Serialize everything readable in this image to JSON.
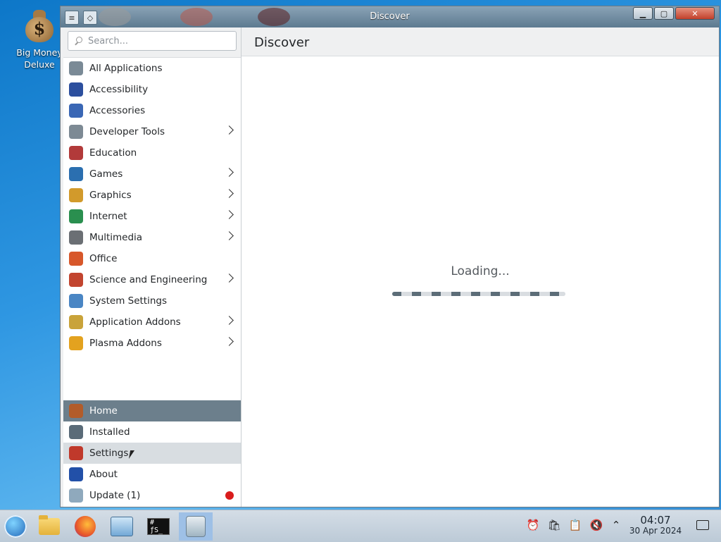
{
  "desktop": {
    "icons": [
      {
        "label_line1": "Big Money",
        "label_line2": "Deluxe"
      }
    ]
  },
  "window": {
    "title": "Discover",
    "controls": {
      "minimize": "▁",
      "maximize": "▢",
      "close": "✕"
    }
  },
  "search": {
    "placeholder": "Search..."
  },
  "categories": [
    {
      "label": "All Applications",
      "icon": "all-apps-icon",
      "color": "#7a8a96",
      "has_submenu": false
    },
    {
      "label": "Accessibility",
      "icon": "accessibility-icon",
      "color": "#2c4f9e",
      "has_submenu": false
    },
    {
      "label": "Accessories",
      "icon": "accessories-icon",
      "color": "#3a67b5",
      "has_submenu": false
    },
    {
      "label": "Developer Tools",
      "icon": "developer-tools-icon",
      "color": "#7d8a94",
      "has_submenu": true
    },
    {
      "label": "Education",
      "icon": "education-icon",
      "color": "#b23a3a",
      "has_submenu": false
    },
    {
      "label": "Games",
      "icon": "games-icon",
      "color": "#2b6fb0",
      "has_submenu": true
    },
    {
      "label": "Graphics",
      "icon": "graphics-icon",
      "color": "#d29a2b",
      "has_submenu": true
    },
    {
      "label": "Internet",
      "icon": "internet-icon",
      "color": "#2a8f4f",
      "has_submenu": true
    },
    {
      "label": "Multimedia",
      "icon": "multimedia-icon",
      "color": "#6b6f74",
      "has_submenu": true
    },
    {
      "label": "Office",
      "icon": "office-icon",
      "color": "#d7572a",
      "has_submenu": false
    },
    {
      "label": "Science and Engineering",
      "icon": "science-icon",
      "color": "#c2452f",
      "has_submenu": true
    },
    {
      "label": "System Settings",
      "icon": "system-settings-icon",
      "color": "#4a86c4",
      "has_submenu": false
    },
    {
      "label": "Application Addons",
      "icon": "application-addons-icon",
      "color": "#c9a33a",
      "has_submenu": true
    },
    {
      "label": "Plasma Addons",
      "icon": "plasma-addons-icon",
      "color": "#e3a21f",
      "has_submenu": true
    }
  ],
  "nav": [
    {
      "label": "Home",
      "icon": "home-icon",
      "color": "#b25c2a",
      "state": "active"
    },
    {
      "label": "Installed",
      "icon": "installed-list-icon",
      "color": "#5a6b78",
      "state": ""
    },
    {
      "label": "Settings",
      "icon": "settings-tools-icon",
      "color": "#c0392b",
      "state": "hover"
    },
    {
      "label": "About",
      "icon": "about-info-icon",
      "color": "#2250a8",
      "state": ""
    },
    {
      "label": "Update (1)",
      "icon": "update-icon",
      "color": "#8fa9bd",
      "state": "",
      "badge": true
    }
  ],
  "main": {
    "title": "Discover",
    "loading_text": "Loading..."
  },
  "taskbar": {
    "clock_time": "04:07",
    "clock_date": "30 Apr 2024",
    "terminal_text": "# ƒS_"
  },
  "colors": {
    "accent": "#6c7f8c",
    "badge": "#d91c1c"
  }
}
